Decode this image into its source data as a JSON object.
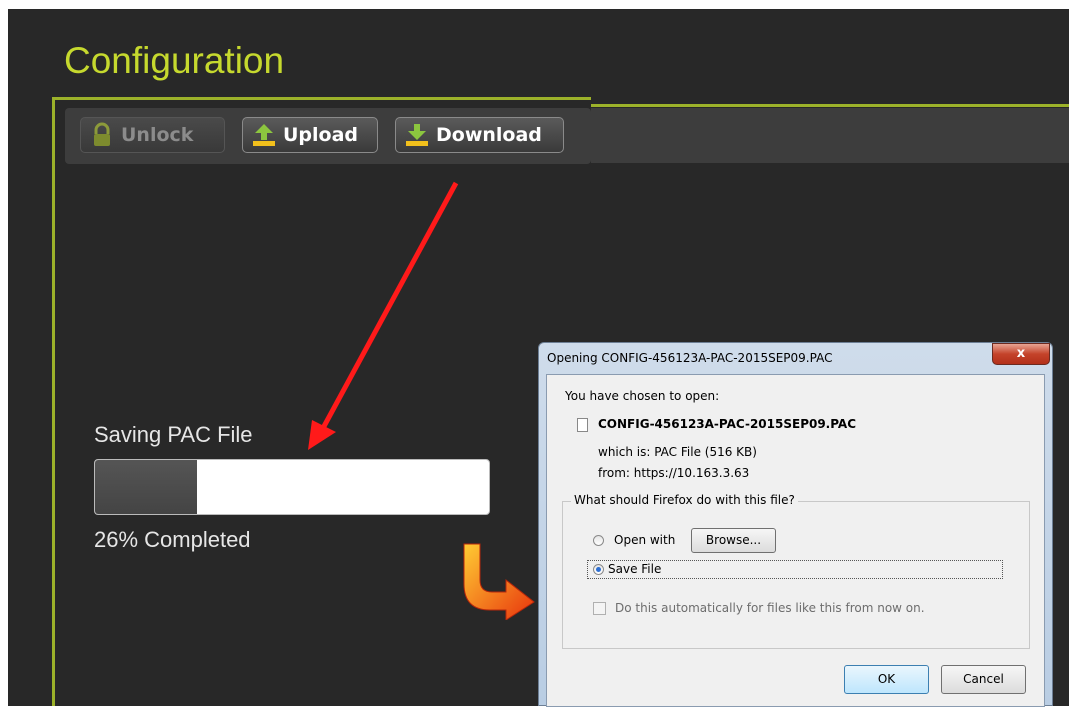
{
  "app": {
    "title": "Configuration",
    "toolbar": {
      "unlock_label": "Unlock",
      "upload_label": "Upload",
      "download_label": "Download"
    },
    "progress": {
      "label": "Saving PAC File",
      "percent": 26,
      "status_text": "26% Completed"
    },
    "colors": {
      "accent": "#c6d92e",
      "frame": "#9cb22a",
      "background": "#282828"
    }
  },
  "dialog": {
    "title": "Opening CONFIG-456123A-PAC-2015SEP09.PAC",
    "close_label": "x",
    "chosen_text": "You have chosen to open:",
    "filename": "CONFIG-456123A-PAC-2015SEP09.PAC",
    "which_is": "which is:  PAC File (516 KB)",
    "from": "from:  https://10.163.3.63",
    "question": "What should Firefox do with this file?",
    "open_with_label": "Open with",
    "browse_label": "Browse...",
    "save_file_label": "Save File",
    "auto_label": "Do this automatically for files like this from now on.",
    "ok_label": "OK",
    "cancel_label": "Cancel",
    "selected_option": "Save File"
  }
}
